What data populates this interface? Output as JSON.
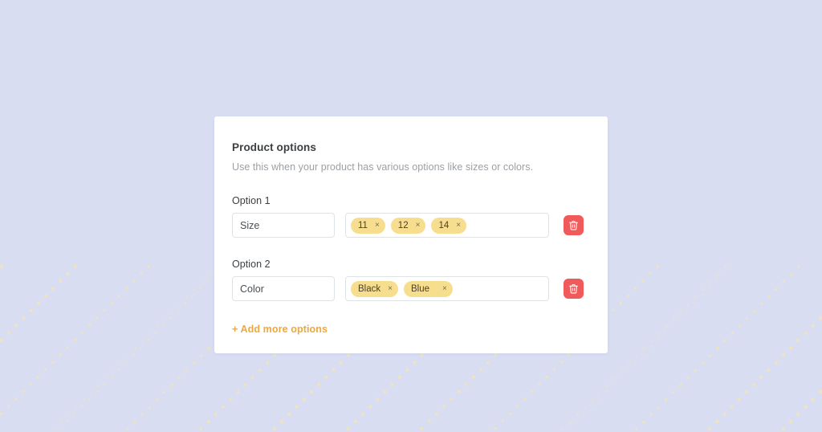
{
  "theme": {
    "page_background": "#d9ddf2",
    "pattern_dot_color": "#f0e4b8",
    "card_background": "#ffffff",
    "chip_background": "#f6de8e",
    "chip_text": "#4a4034",
    "delete_button_color": "#f15a5a",
    "accent_link_color": "#f0a73c",
    "input_border": "#dfe3e8",
    "title_color": "#3c4043",
    "subtitle_color": "#9aa0a6"
  },
  "card": {
    "title": "Product options",
    "subtitle": "Use this when your product has various options like sizes or colors.",
    "options": [
      {
        "label": "Option 1",
        "name_value": "Size",
        "name_placeholder": "Size",
        "tags": [
          {
            "label": "11",
            "remove": "×"
          },
          {
            "label": "12",
            "remove": "×"
          },
          {
            "label": "14",
            "remove": "×"
          }
        ],
        "delete_icon": "trash-icon"
      },
      {
        "label": "Option 2",
        "name_value": "Color",
        "name_placeholder": "Color",
        "tags": [
          {
            "label": "Black",
            "remove": "×"
          },
          {
            "label": "Blue",
            "remove": "×"
          }
        ],
        "delete_icon": "trash-icon"
      }
    ],
    "add_more_label": "+ Add more options"
  }
}
